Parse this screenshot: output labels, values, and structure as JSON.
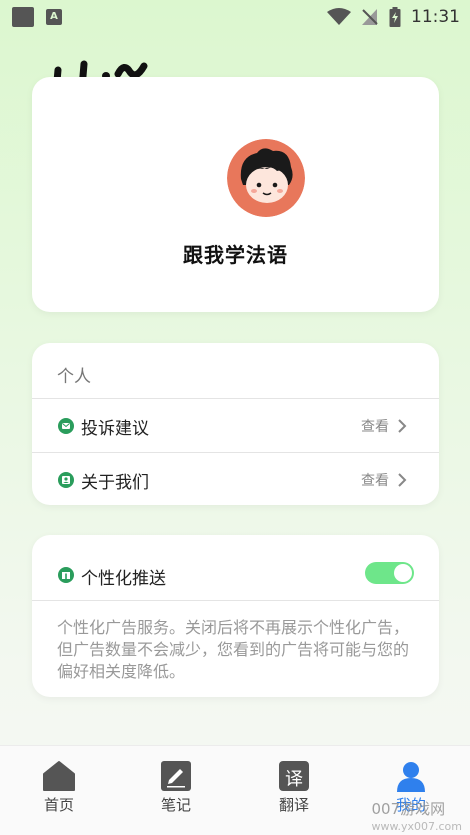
{
  "status_bar": {
    "time": "11:31"
  },
  "header": {
    "greeting": "Hi"
  },
  "profile": {
    "username": "跟我学法语"
  },
  "personal": {
    "title": "个人",
    "items": [
      {
        "label": "投诉建议",
        "action": "查看",
        "icon": "mail-icon"
      },
      {
        "label": "关于我们",
        "action": "查看",
        "icon": "contact-icon"
      }
    ]
  },
  "personalized": {
    "label": "个性化推送",
    "icon": "gift-icon",
    "enabled": true,
    "description": "个性化广告服务。关闭后将不再展示个性化广告，但广告数量不会减少，您看到的广告将可能与您的偏好相关度降低。"
  },
  "bottom_nav": [
    {
      "label": "首页",
      "icon": "home-icon"
    },
    {
      "label": "笔记",
      "icon": "note-icon"
    },
    {
      "label": "翻译",
      "icon": "translate-icon",
      "glyph": "译"
    },
    {
      "label": "我的",
      "icon": "user-icon",
      "active": true
    }
  ],
  "watermark": {
    "text": "007游戏网",
    "url": "www.yx007.com"
  },
  "colors": {
    "accent": "#2a9d5c",
    "toggle_on": "#6ee68a",
    "active_tab": "#2f80ed",
    "avatar_bg": "#e8775b"
  }
}
